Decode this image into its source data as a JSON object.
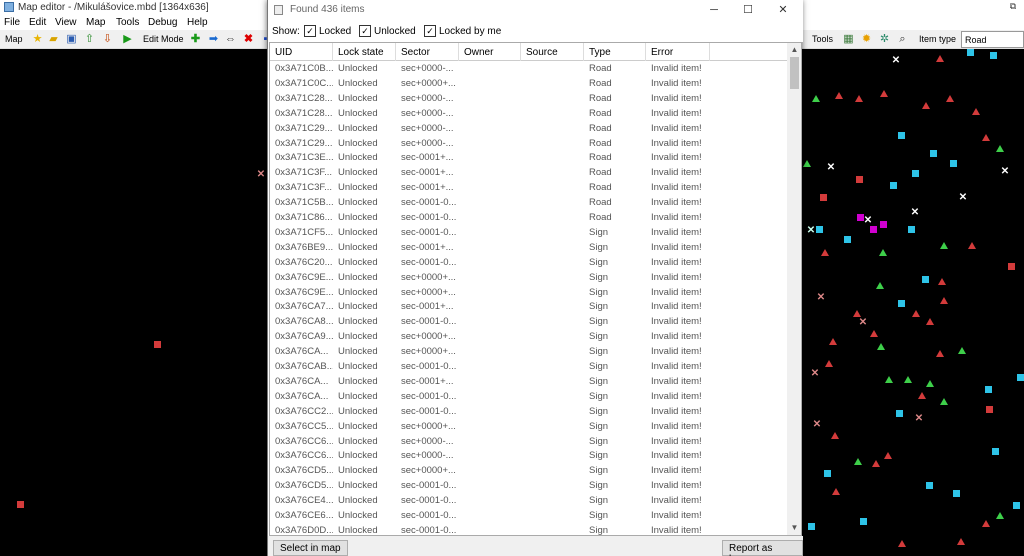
{
  "main_window": {
    "title": "Map editor - /Mikulášovice.mbd [1364x636]",
    "restore_glyph": "⧉",
    "menu": [
      "File",
      "Edit",
      "View",
      "Map",
      "Tools",
      "Debug",
      "Help"
    ],
    "toolbar": {
      "map_label": "Map",
      "edit_mode_label": "Edit Mode",
      "tools_label": "Tools",
      "item_type_label": "Item type",
      "item_type_value": "Road"
    }
  },
  "dialog": {
    "title": "Found 436 items",
    "show_label": "Show:",
    "filters": [
      {
        "label": "Locked",
        "checked": true
      },
      {
        "label": "Unlocked",
        "checked": true
      },
      {
        "label": "Locked by me",
        "checked": true
      }
    ],
    "columns": [
      "UID",
      "Lock state",
      "Sector",
      "Owner",
      "Source",
      "Type",
      "Error"
    ],
    "rows": [
      [
        "0x3A71C0B...",
        "Unlocked",
        "sec+0000-...",
        "",
        "",
        "Road",
        "Invalid item!"
      ],
      [
        "0x3A71C0C...",
        "Unlocked",
        "sec+0000+...",
        "",
        "",
        "Road",
        "Invalid item!"
      ],
      [
        "0x3A71C28...",
        "Unlocked",
        "sec+0000-...",
        "",
        "",
        "Road",
        "Invalid item!"
      ],
      [
        "0x3A71C28...",
        "Unlocked",
        "sec+0000-...",
        "",
        "",
        "Road",
        "Invalid item!"
      ],
      [
        "0x3A71C29...",
        "Unlocked",
        "sec+0000-...",
        "",
        "",
        "Road",
        "Invalid item!"
      ],
      [
        "0x3A71C29...",
        "Unlocked",
        "sec+0000-...",
        "",
        "",
        "Road",
        "Invalid item!"
      ],
      [
        "0x3A71C3E...",
        "Unlocked",
        "sec-0001+...",
        "",
        "",
        "Road",
        "Invalid item!"
      ],
      [
        "0x3A71C3F...",
        "Unlocked",
        "sec-0001+...",
        "",
        "",
        "Road",
        "Invalid item!"
      ],
      [
        "0x3A71C3F...",
        "Unlocked",
        "sec-0001+...",
        "",
        "",
        "Road",
        "Invalid item!"
      ],
      [
        "0x3A71C5B...",
        "Unlocked",
        "sec-0001-0...",
        "",
        "",
        "Road",
        "Invalid item!"
      ],
      [
        "0x3A71C86...",
        "Unlocked",
        "sec-0001-0...",
        "",
        "",
        "Road",
        "Invalid item!"
      ],
      [
        "0x3A71CF5...",
        "Unlocked",
        "sec-0001-0...",
        "",
        "",
        "Sign",
        "Invalid item!"
      ],
      [
        "0x3A76BE9...",
        "Unlocked",
        "sec-0001+...",
        "",
        "",
        "Sign",
        "Invalid item!"
      ],
      [
        "0x3A76C20...",
        "Unlocked",
        "sec-0001-0...",
        "",
        "",
        "Sign",
        "Invalid item!"
      ],
      [
        "0x3A76C9E...",
        "Unlocked",
        "sec+0000+...",
        "",
        "",
        "Sign",
        "Invalid item!"
      ],
      [
        "0x3A76C9E...",
        "Unlocked",
        "sec+0000+...",
        "",
        "",
        "Sign",
        "Invalid item!"
      ],
      [
        "0x3A76CA7...",
        "Unlocked",
        "sec-0001+...",
        "",
        "",
        "Sign",
        "Invalid item!"
      ],
      [
        "0x3A76CA8...",
        "Unlocked",
        "sec-0001-0...",
        "",
        "",
        "Sign",
        "Invalid item!"
      ],
      [
        "0x3A76CA9...",
        "Unlocked",
        "sec+0000+...",
        "",
        "",
        "Sign",
        "Invalid item!"
      ],
      [
        "0x3A76CA...",
        "Unlocked",
        "sec+0000+...",
        "",
        "",
        "Sign",
        "Invalid item!"
      ],
      [
        "0x3A76CAB...",
        "Unlocked",
        "sec-0001-0...",
        "",
        "",
        "Sign",
        "Invalid item!"
      ],
      [
        "0x3A76CA...",
        "Unlocked",
        "sec-0001+...",
        "",
        "",
        "Sign",
        "Invalid item!"
      ],
      [
        "0x3A76CA...",
        "Unlocked",
        "sec-0001-0...",
        "",
        "",
        "Sign",
        "Invalid item!"
      ],
      [
        "0x3A76CC2...",
        "Unlocked",
        "sec-0001-0...",
        "",
        "",
        "Sign",
        "Invalid item!"
      ],
      [
        "0x3A76CC5...",
        "Unlocked",
        "sec+0000+...",
        "",
        "",
        "Sign",
        "Invalid item!"
      ],
      [
        "0x3A76CC6...",
        "Unlocked",
        "sec+0000-...",
        "",
        "",
        "Sign",
        "Invalid item!"
      ],
      [
        "0x3A76CC6...",
        "Unlocked",
        "sec+0000-...",
        "",
        "",
        "Sign",
        "Invalid item!"
      ],
      [
        "0x3A76CD5...",
        "Unlocked",
        "sec+0000+...",
        "",
        "",
        "Sign",
        "Invalid item!"
      ],
      [
        "0x3A76CD5...",
        "Unlocked",
        "sec-0001-0...",
        "",
        "",
        "Sign",
        "Invalid item!"
      ],
      [
        "0x3A76CE4...",
        "Unlocked",
        "sec-0001-0...",
        "",
        "",
        "Sign",
        "Invalid item!"
      ],
      [
        "0x3A76CE6...",
        "Unlocked",
        "sec-0001-0...",
        "",
        "",
        "Sign",
        "Invalid item!"
      ],
      [
        "0x3A76D0D...",
        "Unlocked",
        "sec-0001-0...",
        "",
        "",
        "Sign",
        "Invalid item!"
      ]
    ],
    "select_in_map_label": "Select in map",
    "report_bugs_label": "Report as bugs"
  },
  "colors": {
    "road_marker": "#d33b3b",
    "sign_marker": "#2ec4e8",
    "prefab_marker": "#3ecf4a",
    "selected_marker": "#d000d0"
  }
}
